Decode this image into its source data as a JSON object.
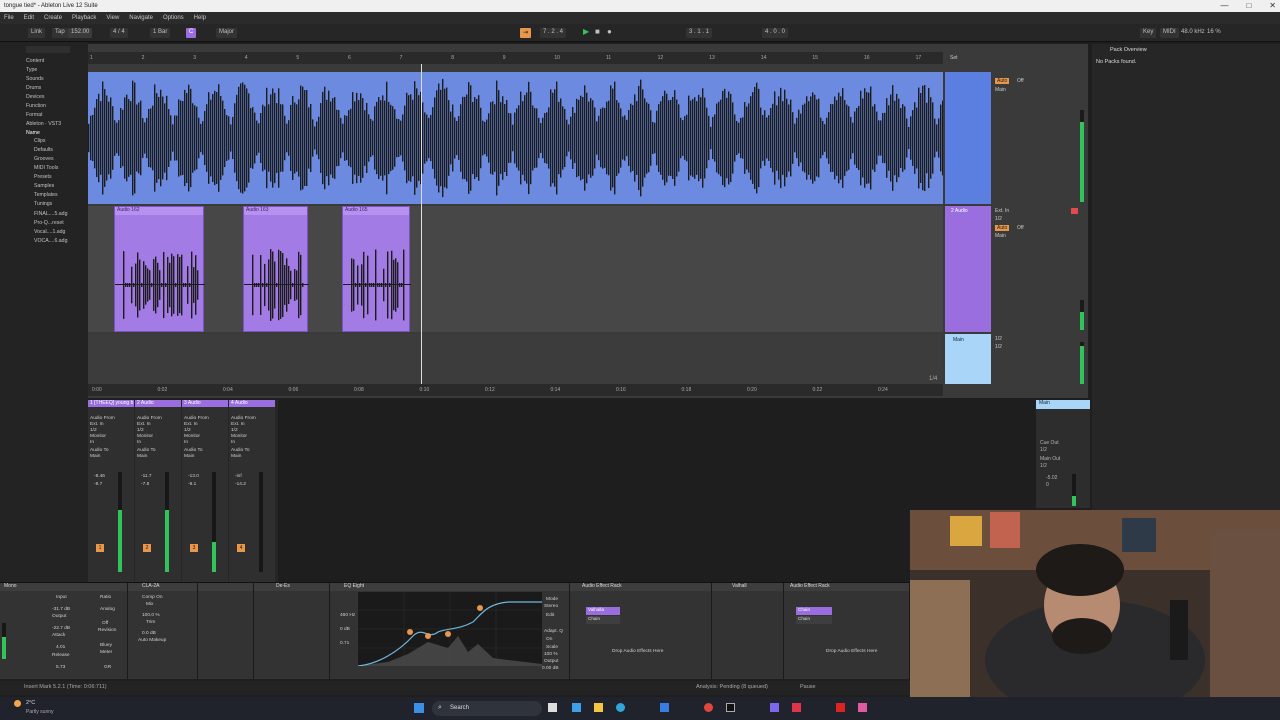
{
  "window": {
    "title": "tongue tied* - Ableton Live 12 Suite",
    "min": "—",
    "max": "□",
    "close": "✕"
  },
  "menu": [
    "File",
    "Edit",
    "Create",
    "Playback",
    "View",
    "Navigate",
    "Options",
    "Help"
  ],
  "transport": {
    "link": "Link",
    "tap": "Tap",
    "tempo": "152.00",
    "meter": "4 / 4",
    "quant": "1 Bar",
    "key": "C",
    "scale": "Major",
    "position": "7 . 2 . 4",
    "loop_start": "3 . 1 . 1",
    "loop_len": "4 . 0 . 0",
    "key_label": "Key",
    "midi_label": "MIDI",
    "sample_rate": "48.0 kHz",
    "cpu": "16 %"
  },
  "browser": {
    "categories": [
      "Content",
      "Type",
      "Sounds",
      "Drums",
      "Devices",
      "Function",
      "Format",
      "Ableton · VST3"
    ],
    "places_header": "Name",
    "items": [
      "Clips",
      "Defaults",
      "Grooves",
      "MIDI Tools",
      "Presets",
      "Samples",
      "Templates",
      "Tunings",
      "FINAL....5.adg",
      "Pro-Q...reset",
      "Vocal....1.adg",
      "VOCA....6.adg"
    ]
  },
  "ruler": {
    "bars": [
      "1",
      "2",
      "3",
      "4",
      "5",
      "6",
      "7",
      "8",
      "9",
      "10",
      "11",
      "12",
      "13",
      "14",
      "15",
      "16",
      "17"
    ],
    "set_label": "Set"
  },
  "tracks": [
    {
      "name": "1 [THEEQ] young b",
      "clip_label": ""
    },
    {
      "name": "2 Audio",
      "clips": [
        "Audio 162",
        "Audio 163",
        "Audio 165"
      ]
    },
    {
      "name": "Main"
    }
  ],
  "timebar": [
    "0:00",
    "0:02",
    "0:04",
    "0:06",
    "0:08",
    "0:10",
    "0:12",
    "0:14",
    "0:16",
    "0:18",
    "0:20",
    "0:22",
    "0:24"
  ],
  "io": {
    "audio_from": "Audio From",
    "ext_in": "Ext. In",
    "ch": "1/2",
    "monitor": "Monitor",
    "in": "In",
    "auto": "Auto",
    "off": "Off",
    "audio_to": "Audio To",
    "main": "Main",
    "zoom": "1/4"
  },
  "mixer": {
    "strips": [
      {
        "name": "1 [THEEQ] young b",
        "vol": "-8.46",
        "peak": "-8.7",
        "num": "1"
      },
      {
        "name": "2 Audio",
        "vol": "-11.7",
        "peak": "-7.8",
        "num": "2"
      },
      {
        "name": "3 Audio",
        "vol": "-13.0",
        "peak": "-9.1",
        "num": "3"
      },
      {
        "name": "4 Audio",
        "vol": "-inf",
        "peak": "-14.2",
        "num": "4"
      }
    ],
    "main": {
      "name": "Main",
      "cue_out": "Cue Out",
      "cue_ch": "1/2",
      "main_out": "Main Out",
      "main_ch": "1/2",
      "vol": "-5.02",
      "peak": "0"
    }
  },
  "devices": [
    {
      "name": "Mono",
      "params": [
        "Input",
        "-31.7 dB",
        "Output",
        "-22.7 dB",
        "Attack",
        "4.01",
        "Release",
        "5.73"
      ]
    },
    {
      "name": "CLA-2A",
      "params": [
        "Ratio",
        "Analog",
        "Off",
        "Revision",
        "Bluey",
        "Meter",
        "GR"
      ]
    },
    {
      "name": "De-Es",
      "params": [
        "Comp On",
        "Mix",
        "100.0 %",
        "Trim",
        "0.0 dB",
        "Auto Makeup"
      ]
    },
    {
      "name": "EQ Eight",
      "params": [
        "Mode",
        "Stereo",
        "Edit",
        "Adapt. Q",
        "On",
        "Scale",
        "100 %",
        "Output",
        "0.00 dB"
      ],
      "gain": "0 dB",
      "freq": "460 Hz",
      "q": "0.71"
    },
    {
      "name": "Audio Effect Rack",
      "drop": "Drop Audio Effects Here",
      "chains": [
        "Valhalla",
        "Chain"
      ]
    },
    {
      "name": "Valhall",
      "params": []
    },
    {
      "name": "Audio Effect Rack",
      "drop": "Drop Audio Effects Here",
      "chains": [
        "Chain",
        "Chain"
      ]
    }
  ],
  "packs": {
    "title": "Pack Overview",
    "empty": "No Packs found."
  },
  "status": {
    "left": "Insert Mark 5.2.1 (Time: 0:06:711)",
    "right": "Analysis: Pending (8 queued)",
    "pause": "Pause"
  },
  "taskbar": {
    "weather_temp": "2°C",
    "weather_desc": "Partly sunny",
    "search": "Search"
  },
  "colors": {
    "track1": "#6b8ae0",
    "track2": "#a27be4",
    "meter": "#31c45a",
    "accent": "#e8964a"
  }
}
